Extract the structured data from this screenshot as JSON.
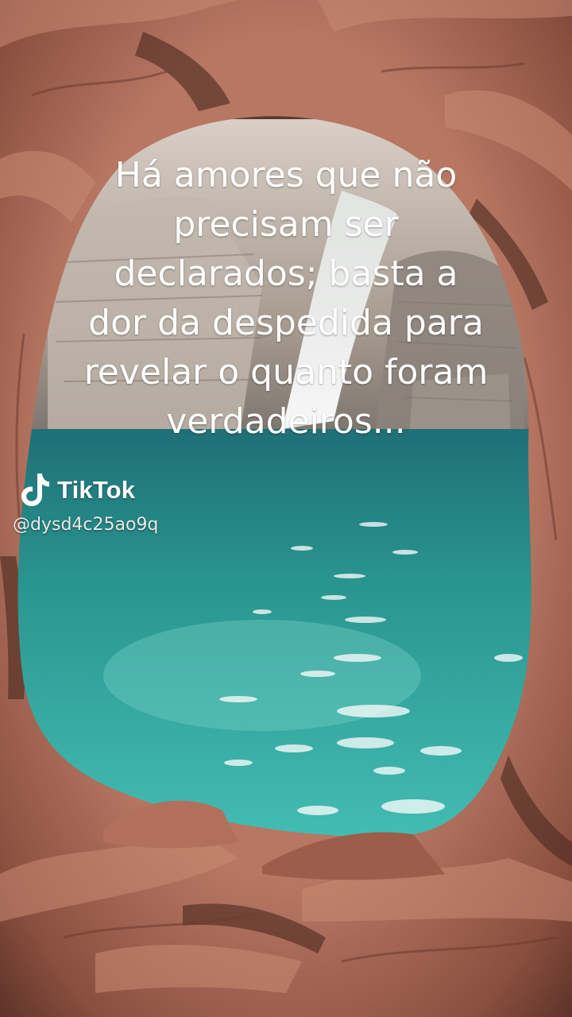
{
  "video": {
    "caption_lines": [
      "Há amores que não",
      "precisam ser",
      "declarados; basta a",
      "dor da despedida para",
      "revelar o quanto foram",
      "verdadeiros..."
    ]
  },
  "watermark": {
    "brand": "TikTok",
    "icon": "tiktok-note-icon",
    "username": "@dysd4c25ao9q"
  },
  "colors": {
    "rock": "#a86a55",
    "rock_dark": "#5a3128",
    "water": "#34b3ad",
    "water_deep": "#1d6f78",
    "text": "#ffffff"
  }
}
